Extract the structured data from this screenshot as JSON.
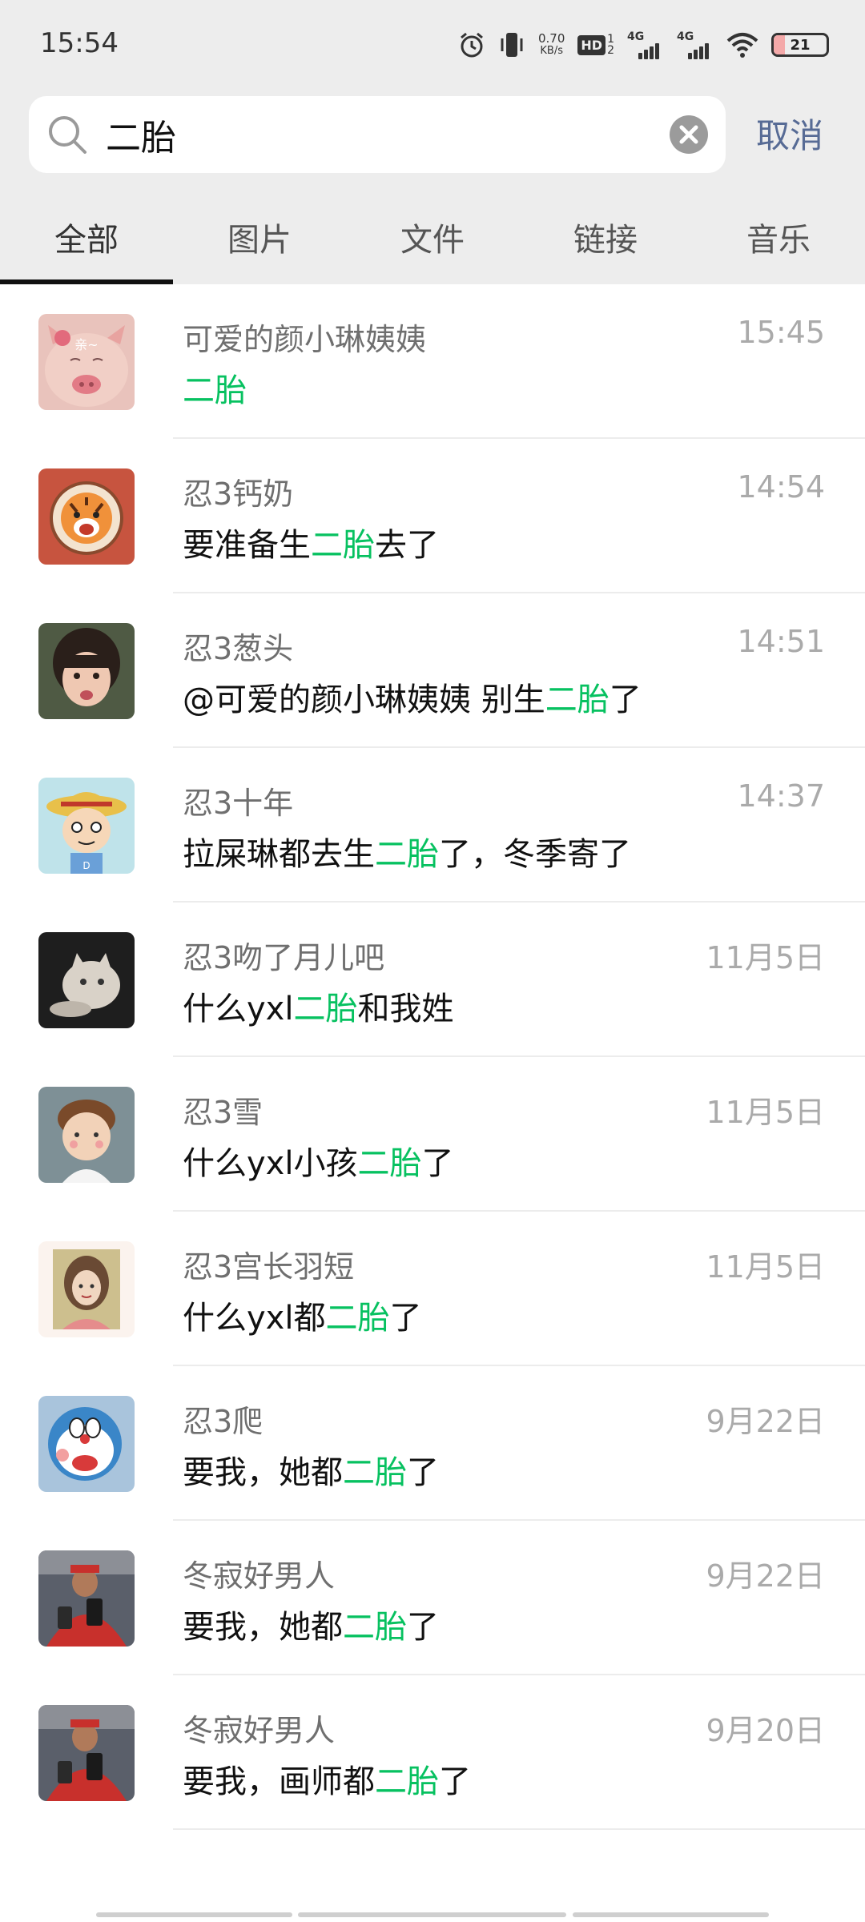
{
  "status_bar": {
    "time": "15:54",
    "net_speed_value": "0.70",
    "net_speed_unit": "KB/s",
    "hd_label": "HD",
    "hd_sub_top": "1",
    "hd_sub_bottom": "2",
    "signal1_label": "4G",
    "signal2_label": "4G",
    "battery_level": "21",
    "icons": [
      "alarm-icon",
      "vibrate-icon",
      "wifi-icon",
      "battery-icon"
    ]
  },
  "search": {
    "query": "二胎",
    "cancel_label": "取消"
  },
  "tabs": [
    {
      "label": "全部",
      "active": true
    },
    {
      "label": "图片",
      "active": false
    },
    {
      "label": "文件",
      "active": false
    },
    {
      "label": "链接",
      "active": false
    },
    {
      "label": "音乐",
      "active": false
    }
  ],
  "colors": {
    "highlight": "#07c160",
    "link": "#576b95",
    "header_bg": "#ededed"
  },
  "results": [
    {
      "sender": "可爱的颜小琳姨姨",
      "time": "15:45",
      "before": "",
      "keyword": "二胎",
      "after": ""
    },
    {
      "sender": "忍3钙奶",
      "time": "14:54",
      "before": "要准备生",
      "keyword": "二胎",
      "after": "去了"
    },
    {
      "sender": "忍3葱头",
      "time": "14:51",
      "before": "@可爱的颜小琳姨姨 别生",
      "keyword": "二胎",
      "after": "了"
    },
    {
      "sender": "忍3十年",
      "time": "14:37",
      "before": "拉屎琳都去生",
      "keyword": "二胎",
      "after": "了，冬季寄了"
    },
    {
      "sender": "忍3吻了月儿吧",
      "time": "11月5日",
      "before": "什么yxl",
      "keyword": "二胎",
      "after": "和我姓"
    },
    {
      "sender": "忍3雪",
      "time": "11月5日",
      "before": "什么yxl小孩",
      "keyword": "二胎",
      "after": "了"
    },
    {
      "sender": "忍3宫长羽短",
      "time": "11月5日",
      "before": "什么yxl都",
      "keyword": "二胎",
      "after": "了"
    },
    {
      "sender": "忍3爬",
      "time": "9月22日",
      "before": "要我，她都",
      "keyword": "二胎",
      "after": "了"
    },
    {
      "sender": "冬寂好男人",
      "time": "9月22日",
      "before": "要我，她都",
      "keyword": "二胎",
      "after": "了"
    },
    {
      "sender": "冬寂好男人",
      "time": "9月20日",
      "before": "要我，画师都",
      "keyword": "二胎",
      "after": "了"
    }
  ],
  "avatar_icons": [
    "pig-face-avatar-icon",
    "tiger-badge-avatar-icon",
    "child-photo-avatar-icon",
    "cartoon-boy-avatar-icon",
    "cat-photo-avatar-icon",
    "cartoon-avatar-icon",
    "girl-drawing-avatar-icon",
    "doraemon-avatar-icon",
    "person-red-jacket-avatar-icon",
    "person-red-jacket-avatar-icon"
  ]
}
